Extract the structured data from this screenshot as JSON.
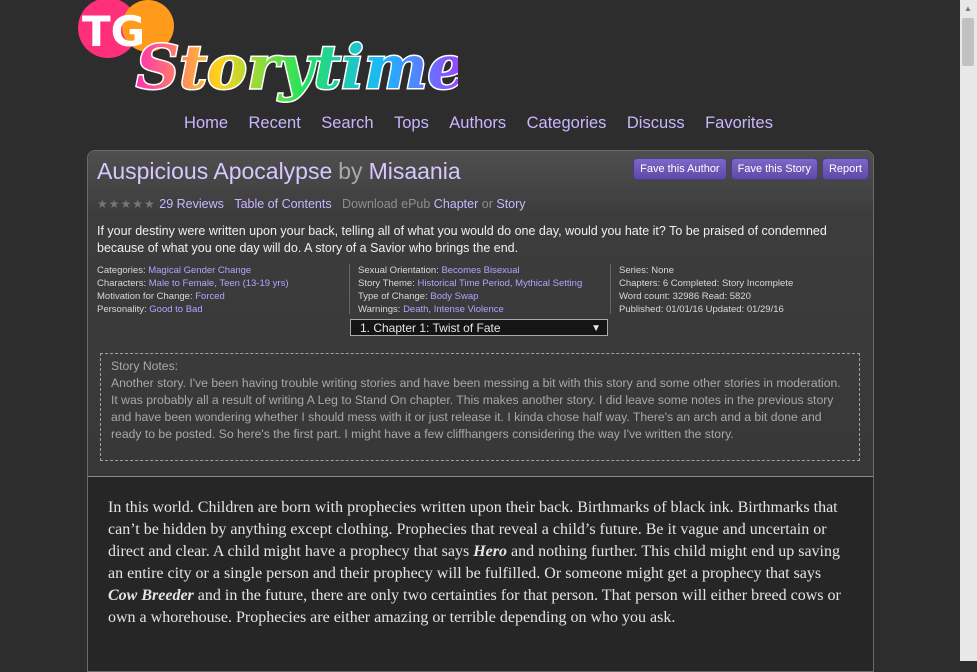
{
  "logo": {
    "text": "TGStorytime",
    "tg": "TG",
    "word": "Storytime"
  },
  "nav": [
    "Home",
    "Recent",
    "Search",
    "Tops",
    "Authors",
    "Categories",
    "Discuss",
    "Favorites"
  ],
  "story": {
    "title": "Auspicious Apocalypse",
    "by": "by",
    "author": "Misaania",
    "buttons": [
      "Fave this Author",
      "Fave this Story",
      "Report"
    ],
    "stars": "★★★★★",
    "reviews": "29 Reviews",
    "toc": "Table of Contents",
    "download": "Download ePub",
    "chapter": "Chapter",
    "or": "or",
    "story_link": "Story",
    "summary": "If your destiny were written upon your back, telling all of what you would do one day, would you hate it? To be praised of condemned because of what you one day will do. A story of a Savior who brings the end.",
    "meta": {
      "categories_label": "Categories:",
      "categories": "Magical Gender Change",
      "characters_label": "Characters:",
      "characters": "Male to Female, Teen (13-19 yrs)",
      "motivation_label": "Motivation for Change:",
      "motivation": "Forced",
      "personality_label": "Personality:",
      "personality": "Good to Bad",
      "orientation_label": "Sexual Orientation:",
      "orientation": "Becomes Bisexual",
      "theme_label": "Story Theme:",
      "theme": "Historical Time Period, Mythical Setting",
      "type_label": "Type of Change:",
      "type": "Body Swap",
      "warnings_label": "Warnings:",
      "warnings": "Death, Intense Violence",
      "series": "Series: None",
      "chapters": "Chapters: 6 Completed: Story Incomplete",
      "wordcount": "Word count: 32986 Read: 5820",
      "published": "Published: 01/01/16 Updated: 01/29/16"
    },
    "chapter_select": "1. Chapter 1: Twist of Fate",
    "notes_label": "Story Notes:",
    "notes": "Another story. I've been having trouble writing stories and have been messing a bit with this story and some other stories in moderation. It was probably all a result of writing A Leg to Stand On chapter. This makes another story. I did leave some notes in the previous story and have been wondering whether I should mess with it or just release it. I kinda chose half way. There's an arch and a bit done and ready to be posted. So here's the first part. I might have a few cliffhangers considering the way I've written the story.",
    "body": {
      "p1": "In this world. Children are born with prophecies written upon their back. Birthmarks of black ink. Birthmarks that can’t be hidden by anything except clothing. Prophecies that reveal a child’s future. Be it vague and uncertain or direct and clear. A child might have a prophecy that says ",
      "em1": "Hero",
      "p2": " and nothing further. This child might end up saving an entire city or a single person and their prophecy will be fulfilled. Or someone might get a prophecy that says ",
      "em2": "Cow Breeder",
      "p3": " and in the future, there are only two certainties for that person. That person will either breed cows or own a whorehouse. Prophecies are either amazing or terrible depending on who you ask."
    }
  }
}
